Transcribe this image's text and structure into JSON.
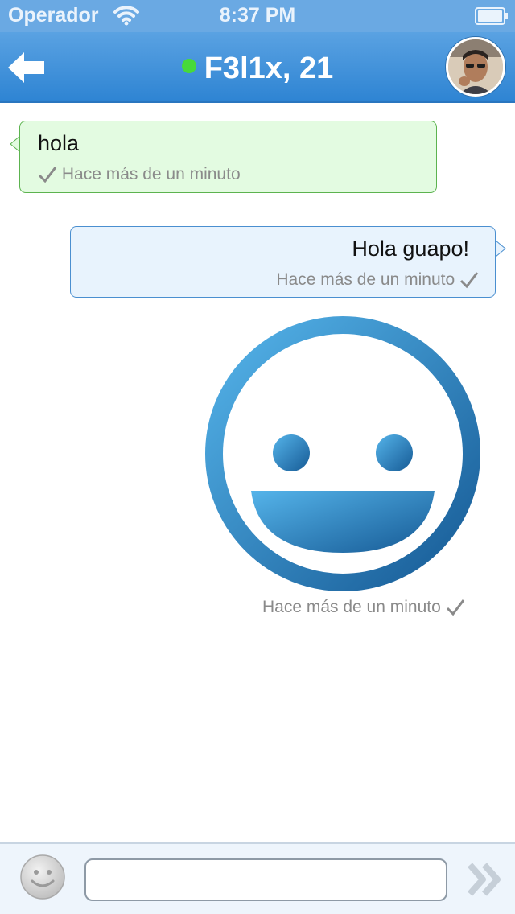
{
  "status_bar": {
    "carrier": "Operador",
    "time": "8:37 PM"
  },
  "header": {
    "title": "F3l1x, 21",
    "online_status_color": "#47d93b",
    "back_icon": "back-arrow-icon",
    "avatar_icon": "user-avatar"
  },
  "messages": [
    {
      "direction": "incoming",
      "text": "hola",
      "meta": "Hace más de un minuto",
      "status_icon": "checkmark-icon"
    },
    {
      "direction": "outgoing",
      "text": "Hola guapo!",
      "meta": "Hace más de un minuto",
      "status_icon": "checkmark-icon"
    },
    {
      "direction": "outgoing",
      "type": "sticker",
      "sticker_icon": "big-smiley-sticker",
      "meta": "Hace más de un minuto",
      "status_icon": "checkmark-icon"
    }
  ],
  "input_bar": {
    "emoji_icon": "smiley-face-icon",
    "input_value": "",
    "send_icon": "double-chevron-right-icon"
  },
  "colors": {
    "nav_gradient_top": "#5aa2e2",
    "nav_gradient_bottom": "#2e84d3",
    "incoming_bubble": "#e3fbe1",
    "outgoing_bubble": "#e8f3fd",
    "sticker_blue": "#2a80c8"
  }
}
